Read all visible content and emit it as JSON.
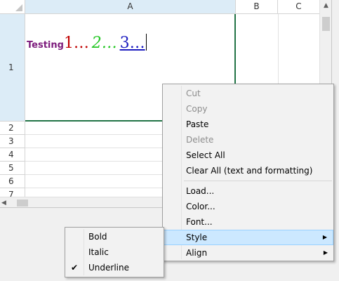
{
  "grid": {
    "columns": [
      "A",
      "B",
      "C"
    ],
    "rows": [
      "1",
      "2",
      "3",
      "4",
      "5",
      "6",
      "7"
    ],
    "cell_a1": {
      "testing": "Testing",
      "one": "1…",
      "two": "2…",
      "three": "3…"
    }
  },
  "context_menu": {
    "items": [
      {
        "label": "Cut",
        "enabled": false
      },
      {
        "label": "Copy",
        "enabled": false
      },
      {
        "label": "Paste",
        "enabled": true
      },
      {
        "label": "Delete",
        "enabled": false
      },
      {
        "label": "Select All",
        "enabled": true
      },
      {
        "label": "Clear All (text and formatting)",
        "enabled": true
      },
      {
        "label": "Load...",
        "enabled": true
      },
      {
        "label": "Color...",
        "enabled": true
      },
      {
        "label": "Font...",
        "enabled": true
      },
      {
        "label": "Style",
        "enabled": true,
        "submenu": true,
        "highlighted": true
      },
      {
        "label": "Align",
        "enabled": true,
        "submenu": true
      }
    ]
  },
  "style_submenu": {
    "items": [
      {
        "label": "Bold",
        "checked": false
      },
      {
        "label": "Italic",
        "checked": false
      },
      {
        "label": "Underline",
        "checked": true
      }
    ]
  },
  "colors": {
    "selection_header": "#dcecf7",
    "active_cell_border": "#217346",
    "menu_highlight": "#cce8ff"
  },
  "icons": {
    "submenu_arrow": "right-triangle-icon",
    "checkmark": "checkmark-icon"
  }
}
